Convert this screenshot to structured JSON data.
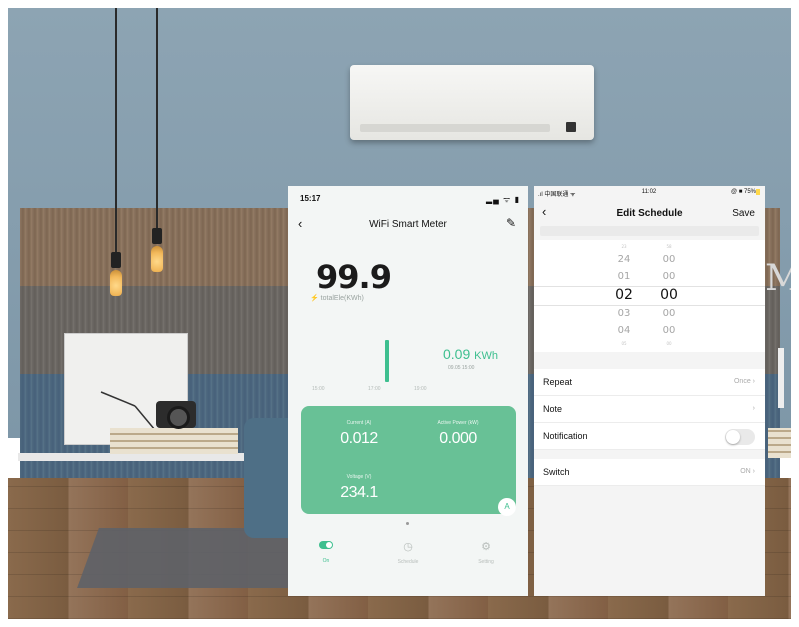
{
  "meter_app": {
    "status_time": "15:17",
    "status_icons": "▂▄ ᯤ ▮",
    "title": "WiFi Smart Meter",
    "back_icon": "‹",
    "edit_icon": "✎",
    "total_value": "99.9",
    "total_label": "totalEle(KWh)",
    "bar_reading": "0.09",
    "bar_unit": "KWh",
    "bar_timestamp": "09.05 15:00",
    "axis_ticks": [
      "15:00",
      "17:00",
      "19:00"
    ],
    "current_label": "Current (A)",
    "current_value": "0.012",
    "power_label": "Active Power (kW)",
    "power_value": "0.000",
    "voltage_label": "Voltage (V)",
    "voltage_value": "234.1",
    "badge": "A",
    "tabs": [
      {
        "label": "On"
      },
      {
        "label": "Schedule"
      },
      {
        "label": "Setting"
      }
    ],
    "accent": "#3dbf8f"
  },
  "schedule_app": {
    "status_carrier": ".ıl 中国联通 ᯤ",
    "status_time": "11:02",
    "status_battery": "@ ■ 75%",
    "battery_tag": " ",
    "back_icon": "‹",
    "title": "Edit Schedule",
    "save_label": "Save",
    "hours": [
      "23",
      "24",
      "01",
      "02",
      "03",
      "04",
      "05"
    ],
    "minutes": [
      "58",
      "00",
      "00",
      "00",
      "00",
      "00",
      "00"
    ],
    "rows": {
      "repeat_label": "Repeat",
      "repeat_value": "Once ›",
      "note_label": "Note",
      "note_value": "›",
      "notification_label": "Notification",
      "switch_label": "Switch",
      "switch_value": "ON ›"
    }
  }
}
